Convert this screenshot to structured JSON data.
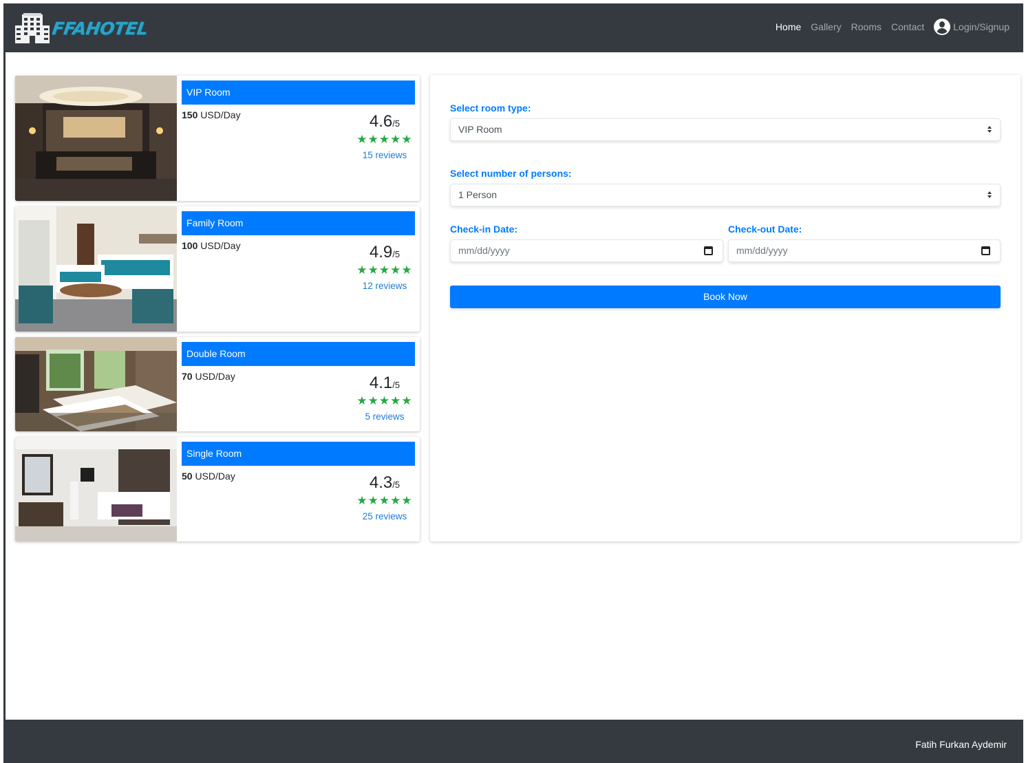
{
  "header": {
    "brand": "FFAHOTEL",
    "nav": {
      "home": "Home",
      "gallery": "Gallery",
      "rooms": "Rooms",
      "contact": "Contact",
      "login": "Login/Signup"
    },
    "icons": {
      "logo": "hotel-building-icon",
      "user": "user-circle-icon"
    }
  },
  "rooms": [
    {
      "name": "VIP Room",
      "price": "150",
      "unit": "USD/Day",
      "rating": "4.6",
      "scale": "/5",
      "stars": "★★★★★",
      "reviews": "15 reviews"
    },
    {
      "name": "Family Room",
      "price": "100",
      "unit": "USD/Day",
      "rating": "4.9",
      "scale": "/5",
      "stars": "★★★★★",
      "reviews": "12 reviews"
    },
    {
      "name": "Double Room",
      "price": "70",
      "unit": "USD/Day",
      "rating": "4.1",
      "scale": "/5",
      "stars": "★★★★★",
      "reviews": "5 reviews"
    },
    {
      "name": "Single Room",
      "price": "50",
      "unit": "USD/Day",
      "rating": "4.3",
      "scale": "/5",
      "stars": "★★★★★",
      "reviews": "25 reviews"
    }
  ],
  "booking": {
    "room_type_label": "Select room type:",
    "room_type_value": "VIP Room",
    "persons_label": "Select number of persons:",
    "persons_value": "1 Person",
    "checkin_label": "Check-in Date:",
    "checkin_placeholder": "mm/dd/yyyy",
    "checkout_label": "Check-out Date:",
    "checkout_placeholder": "mm/dd/yyyy",
    "book_button": "Book Now"
  },
  "footer": {
    "author": "Fatih Furkan Aydemir"
  },
  "colors": {
    "navbar": "#343a40",
    "primary": "#007bff",
    "stars": "#28a745",
    "logo": "#2aa4c9"
  }
}
